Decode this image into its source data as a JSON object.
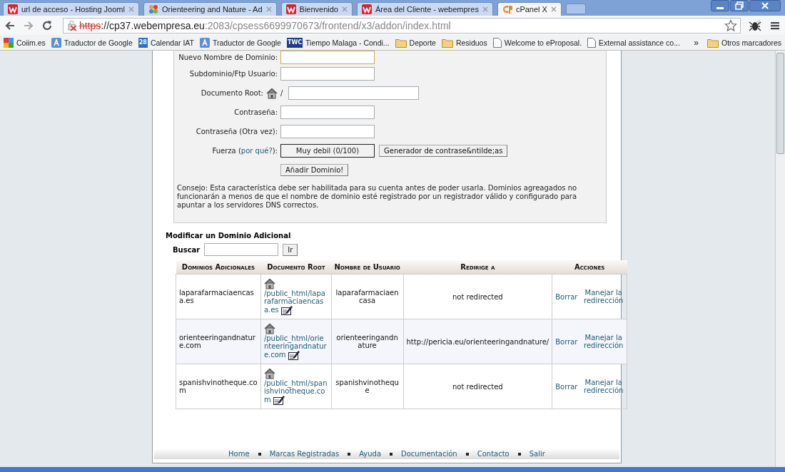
{
  "tabs": [
    {
      "title": "url de acceso - Hosting Jooml",
      "kind": "w",
      "selected": false
    },
    {
      "title": "Orienteering and Nature - Ad",
      "kind": "joomla",
      "selected": false
    },
    {
      "title": "Bienvenido",
      "kind": "w",
      "selected": false
    },
    {
      "title": "Área del Cliente - webempres",
      "kind": "w",
      "selected": false
    },
    {
      "title": "cPanel X",
      "kind": "cp",
      "selected": true
    }
  ],
  "address": {
    "scheme": "https",
    "host": "://cp37.webempresa.eu",
    "path": ":2083/cpsess6699970673/frontend/x3/addon/index.html",
    "insecure": true
  },
  "bookmarks": [
    {
      "label": "Coiim.es",
      "kind": "google"
    },
    {
      "label": "Traductor de Google",
      "kind": "translate"
    },
    {
      "label": "Calendar IAT",
      "kind": "calendar",
      "badge": "28"
    },
    {
      "label": "Traductor de Google",
      "kind": "translate"
    },
    {
      "label": "Tiempo Malaga - Condi...",
      "kind": "weather",
      "badge": "TWC"
    },
    {
      "label": "Deporte",
      "kind": "folder"
    },
    {
      "label": "Residuos",
      "kind": "folder"
    },
    {
      "label": "Welcome to eProposal.",
      "kind": "page"
    },
    {
      "label": "External assistance co...",
      "kind": "page"
    }
  ],
  "bookmarks_more": "»",
  "other_bookmarks": "Otros marcadores",
  "form": {
    "fields": [
      {
        "label": "Nuevo Nombre de Dominio:",
        "kind": "text",
        "focused": true
      },
      {
        "label": "Subdominio/Ftp Usuario:",
        "kind": "text",
        "focused": false
      },
      {
        "label": "Documento Root:",
        "kind": "docroot",
        "prefix": "/",
        "focused": false
      },
      {
        "label": "Contraseña:",
        "kind": "text",
        "focused": false
      },
      {
        "label": "Contraseña (Otra vez):",
        "kind": "text",
        "focused": false
      }
    ],
    "strength": {
      "label_start": "Fuerza (",
      "link": "por qué?",
      "label_end": "):",
      "meter": "Muy debil (0/100)",
      "generator": "Generador de contrase&ntilde;as"
    },
    "submit": "Añadir Dominio!",
    "advice": "Consejo: Esta característica debe ser habilitada para su cuenta antes de poder usarla. Dominios agreagados no funcionarán a menos de que el nombre de dominio esté registrado por un registrador válido y configurado para apuntar a los servidores DNS correctos."
  },
  "section_title": "Modificar un Dominio Adicional",
  "search": {
    "label": "Buscar",
    "button": "Ir"
  },
  "table": {
    "columns": [
      "Dominios Adicionales",
      "Documento Root",
      "Nombre de Usuario",
      "Redirige a",
      "Acciones"
    ],
    "rows": [
      {
        "domain": "laparafarmaciaencasa.es",
        "docroot": "/public_html/laparafarmaciaencasa.es",
        "user": "laparafarmaciaencasa",
        "redirect": "not redirected",
        "delete": "Borrar",
        "manage": "Manejar la redirección"
      },
      {
        "domain": "orienteeringandnature.com",
        "docroot": "/public_html/orienteeringandnature.com",
        "user": "orienteeringandnature",
        "redirect": "http://pericia.eu/orienteeringandnature/",
        "delete": "Borrar",
        "manage": "Manejar la redirección"
      },
      {
        "domain": "spanishvinotheque.com",
        "docroot": "/public_html/spanishvinotheque.com",
        "user": "spanishvinotheque",
        "redirect": "not redirected",
        "delete": "Borrar",
        "manage": "Manejar la redirección"
      }
    ]
  },
  "footer": [
    "Home",
    "Marcas Registradas",
    "Ayuda",
    "Documentación",
    "Contacto",
    "Salir"
  ]
}
